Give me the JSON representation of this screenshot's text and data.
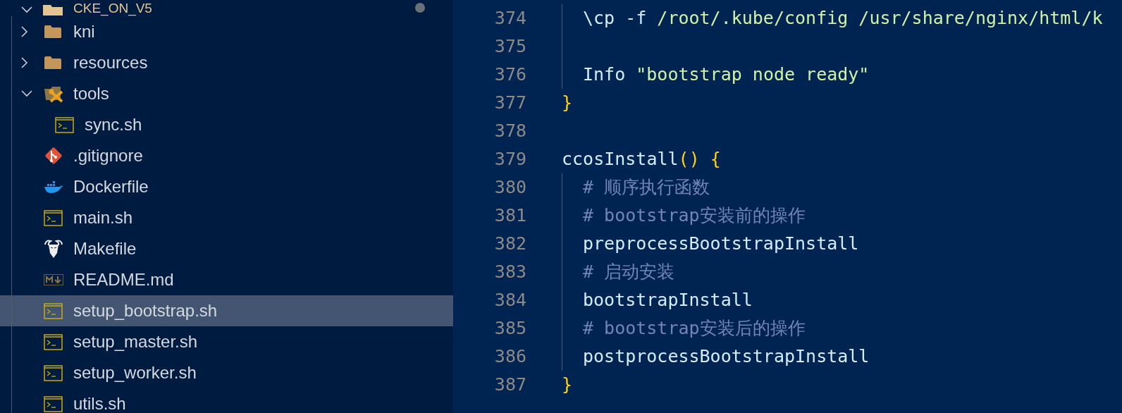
{
  "sidebar": {
    "root": {
      "label": "CKE_ON_V5",
      "expanded": true,
      "modified": true
    },
    "items": [
      {
        "label": "kni",
        "kind": "folder",
        "expanded": false,
        "selected": false
      },
      {
        "label": "resources",
        "kind": "folder",
        "expanded": false,
        "selected": false
      },
      {
        "label": "tools",
        "kind": "tools-folder",
        "expanded": true,
        "selected": false,
        "children": [
          {
            "label": "sync.sh",
            "kind": "shell",
            "selected": false
          }
        ]
      },
      {
        "label": ".gitignore",
        "kind": "git",
        "selected": false
      },
      {
        "label": "Dockerfile",
        "kind": "docker",
        "selected": false
      },
      {
        "label": "main.sh",
        "kind": "shell",
        "selected": false
      },
      {
        "label": "Makefile",
        "kind": "gnu",
        "selected": false
      },
      {
        "label": "README.md",
        "kind": "markdown",
        "selected": false
      },
      {
        "label": "setup_bootstrap.sh",
        "kind": "shell",
        "selected": true
      },
      {
        "label": "setup_master.sh",
        "kind": "shell",
        "selected": false
      },
      {
        "label": "setup_worker.sh",
        "kind": "shell",
        "selected": false
      },
      {
        "label": "utils.sh",
        "kind": "shell",
        "selected": false
      }
    ]
  },
  "editor": {
    "lines": [
      {
        "number": "374",
        "indent": true,
        "tokens": [
          {
            "kind": "plain",
            "text": "\\cp -f "
          },
          {
            "kind": "string",
            "text": "/root/.kube/config /usr/share/nginx/html/k"
          }
        ]
      },
      {
        "number": "375",
        "indent": true
      },
      {
        "number": "376",
        "indent": true,
        "tokens": [
          {
            "kind": "plain",
            "text": "Info "
          },
          {
            "kind": "string",
            "text": "\"bootstrap node ready\""
          }
        ]
      },
      {
        "number": "377",
        "indent": false,
        "tokens": [
          {
            "kind": "brace",
            "text": "}"
          }
        ]
      },
      {
        "number": "378",
        "indent": false
      },
      {
        "number": "379",
        "indent": false,
        "tokens": [
          {
            "kind": "plain",
            "text": "ccosInstall"
          },
          {
            "kind": "brace",
            "text": "() {"
          }
        ]
      },
      {
        "number": "380",
        "indent": true,
        "tokens": [
          {
            "kind": "comment",
            "text": "# 顺序执行函数"
          }
        ]
      },
      {
        "number": "381",
        "indent": true,
        "tokens": [
          {
            "kind": "comment",
            "text": "# bootstrap安装前的操作"
          }
        ]
      },
      {
        "number": "382",
        "indent": true,
        "tokens": [
          {
            "kind": "plain",
            "text": "preprocessBootstrapInstall"
          }
        ]
      },
      {
        "number": "383",
        "indent": true,
        "tokens": [
          {
            "kind": "comment",
            "text": "# 启动安装"
          }
        ]
      },
      {
        "number": "384",
        "indent": true,
        "tokens": [
          {
            "kind": "plain",
            "text": "bootstrapInstall"
          }
        ]
      },
      {
        "number": "385",
        "indent": true,
        "tokens": [
          {
            "kind": "comment",
            "text": "# bootstrap安装后的操作"
          }
        ]
      },
      {
        "number": "386",
        "indent": true,
        "tokens": [
          {
            "kind": "plain",
            "text": "postprocessBootstrapInstall"
          }
        ]
      },
      {
        "number": "387",
        "indent": false,
        "tokens": [
          {
            "kind": "brace",
            "text": "}"
          }
        ]
      }
    ]
  }
}
